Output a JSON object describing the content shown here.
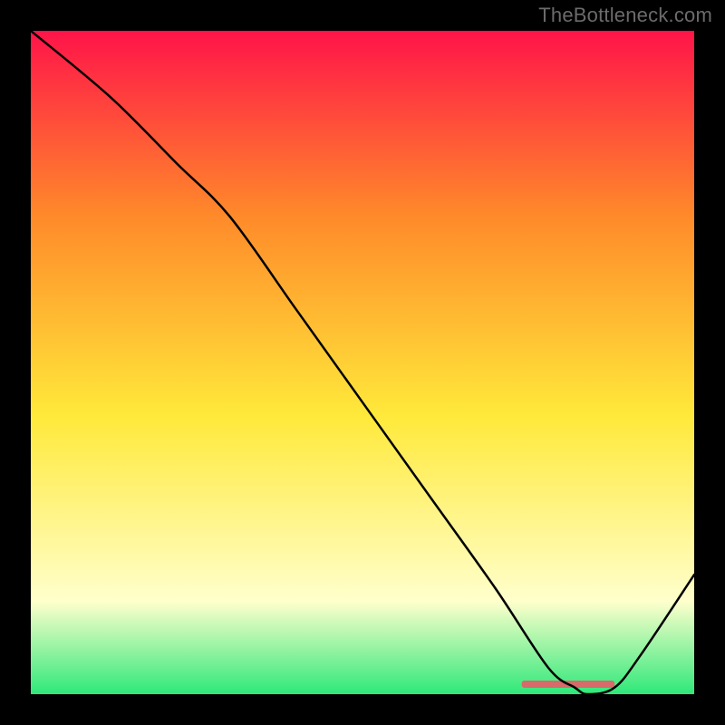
{
  "watermark": "TheBottleneck.com",
  "chart_data": {
    "type": "line",
    "title": "",
    "xlabel": "",
    "ylabel": "",
    "xlim": [
      0,
      100
    ],
    "ylim": [
      0,
      100
    ],
    "grid": false,
    "series": [
      {
        "name": "curve",
        "x": [
          0,
          12,
          22,
          30,
          40,
          50,
          60,
          70,
          78,
          82,
          84,
          88,
          92,
          100
        ],
        "values": [
          100,
          90,
          80,
          72,
          58,
          44,
          30,
          16,
          4,
          1,
          0,
          1,
          6,
          18
        ]
      }
    ],
    "marker": {
      "name": "highlight-band",
      "x_start": 74,
      "x_end": 88,
      "y": 1.5,
      "color": "#d76a6a"
    },
    "background_gradient": {
      "top": "#ff1449",
      "upper": "#ff8a2a",
      "mid": "#ffe93a",
      "lower": "#ffffcc",
      "bottom": "#2fe87a"
    }
  }
}
